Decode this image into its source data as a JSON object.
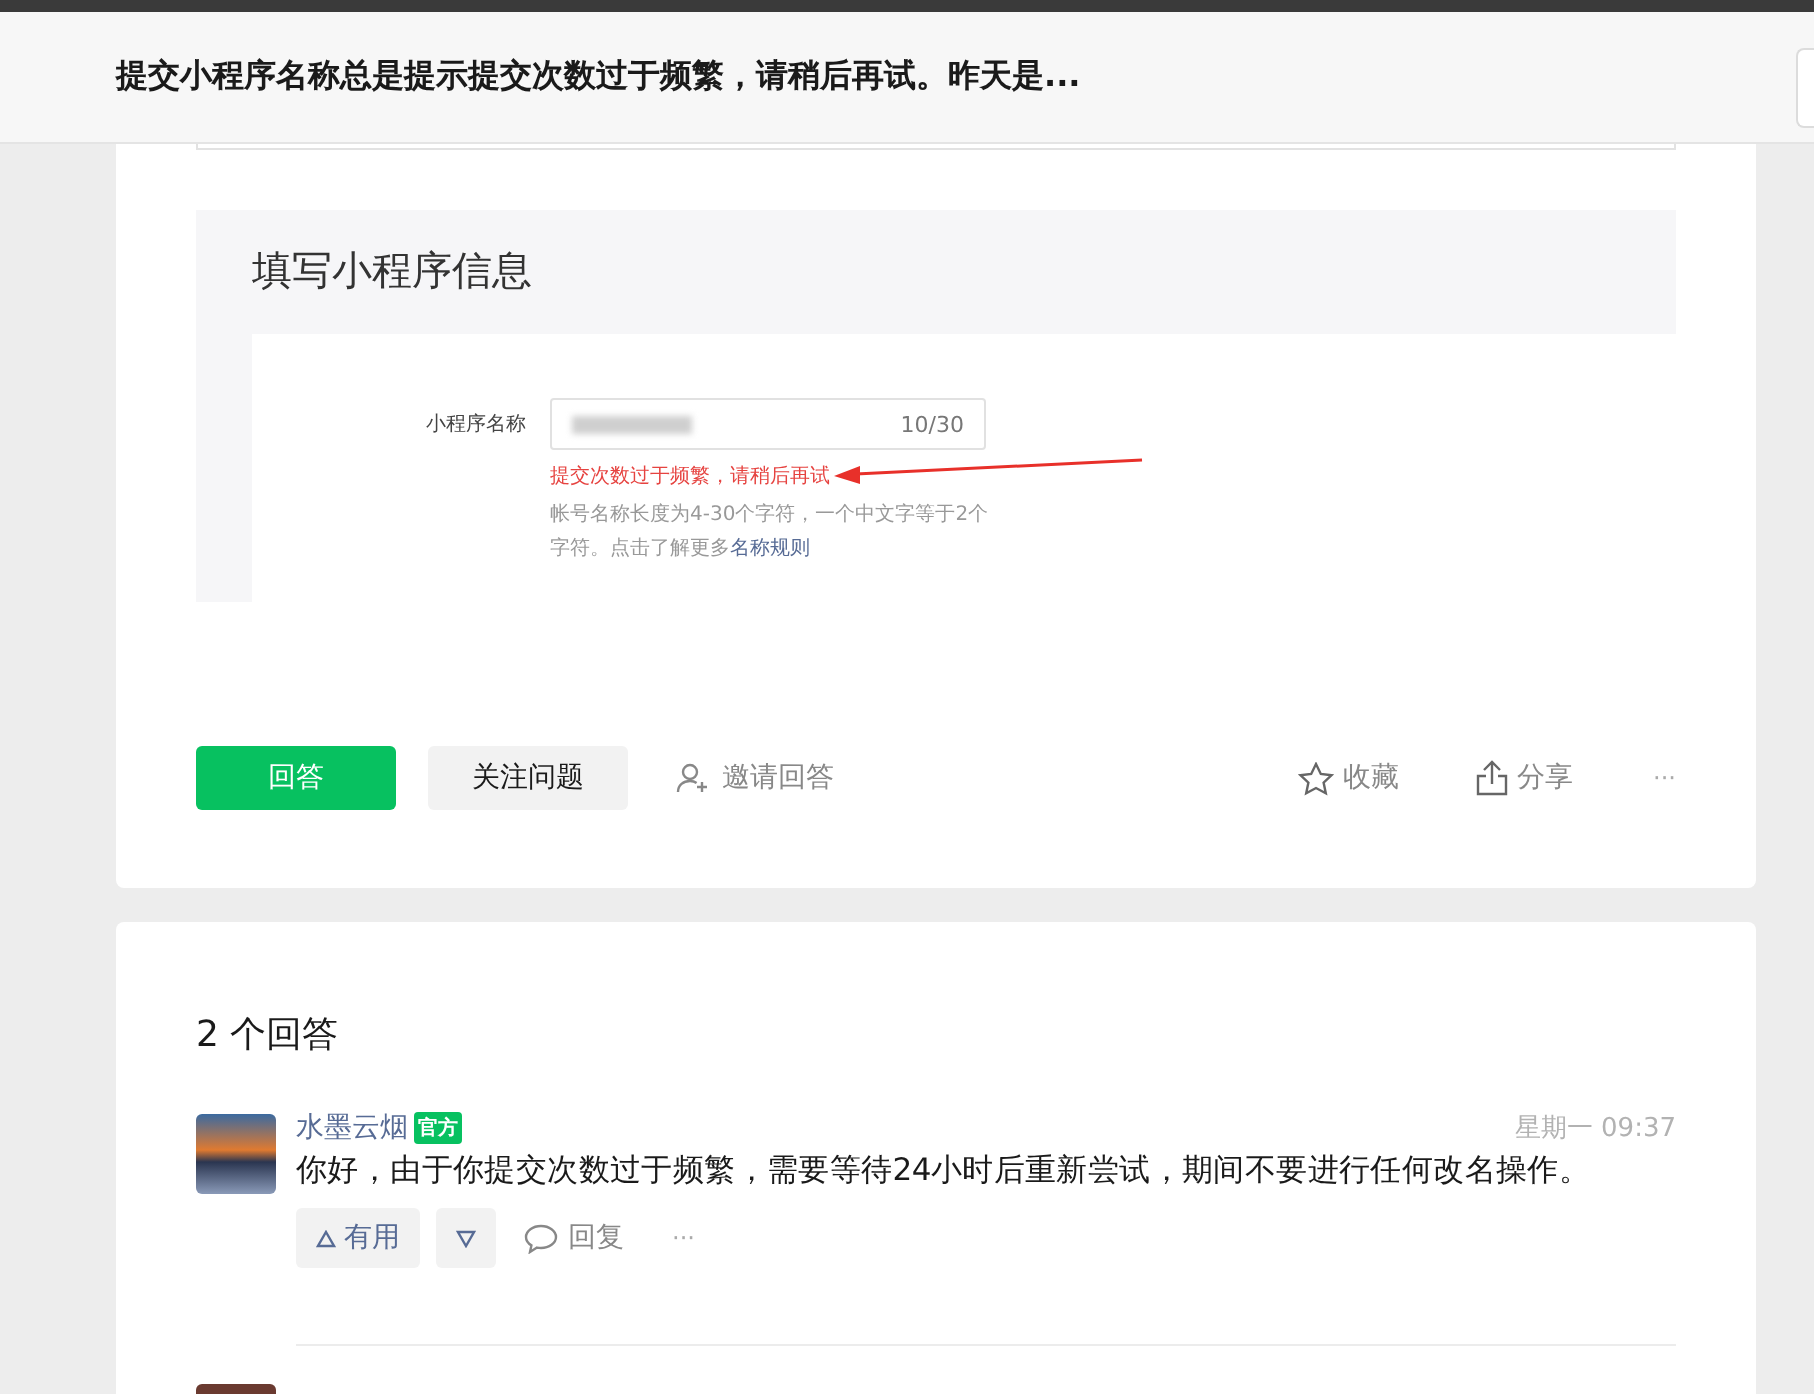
{
  "header": {
    "title": "提交小程序名称总是提示提交次数过于频繁，请稍后再试。昨天是..."
  },
  "question": {
    "screenshot": {
      "title": "填写小程序信息",
      "field_label": "小程序名称",
      "counter": "10/30",
      "error": "提交次数过于频繁，请稍后再试",
      "hint": "帐号名称长度为4-30个字符，一个中文字等于2个字符。点击了解更多",
      "hint_link": "名称规则"
    },
    "actions": [
      {
        "label": "回答",
        "kind": "primary"
      },
      {
        "label": "关注问题",
        "kind": "secondary"
      },
      {
        "label": "邀请回答",
        "kind": "invite"
      }
    ],
    "side_actions": [
      {
        "label": "收藏",
        "kind": "star"
      },
      {
        "label": "分享",
        "kind": "share"
      },
      {
        "label": "···",
        "kind": "more"
      }
    ]
  },
  "answers": {
    "count_title": "2 个回答",
    "items": [
      {
        "author": "水墨云烟",
        "badge": "官方",
        "time": "星期一 09:37",
        "text": "你好，由于你提交次数过于频繁，需要等待24小时后重新尝试，期间不要进行任何改名操作。",
        "useful": "有用",
        "reply": "回复",
        "more": "···"
      }
    ]
  }
}
